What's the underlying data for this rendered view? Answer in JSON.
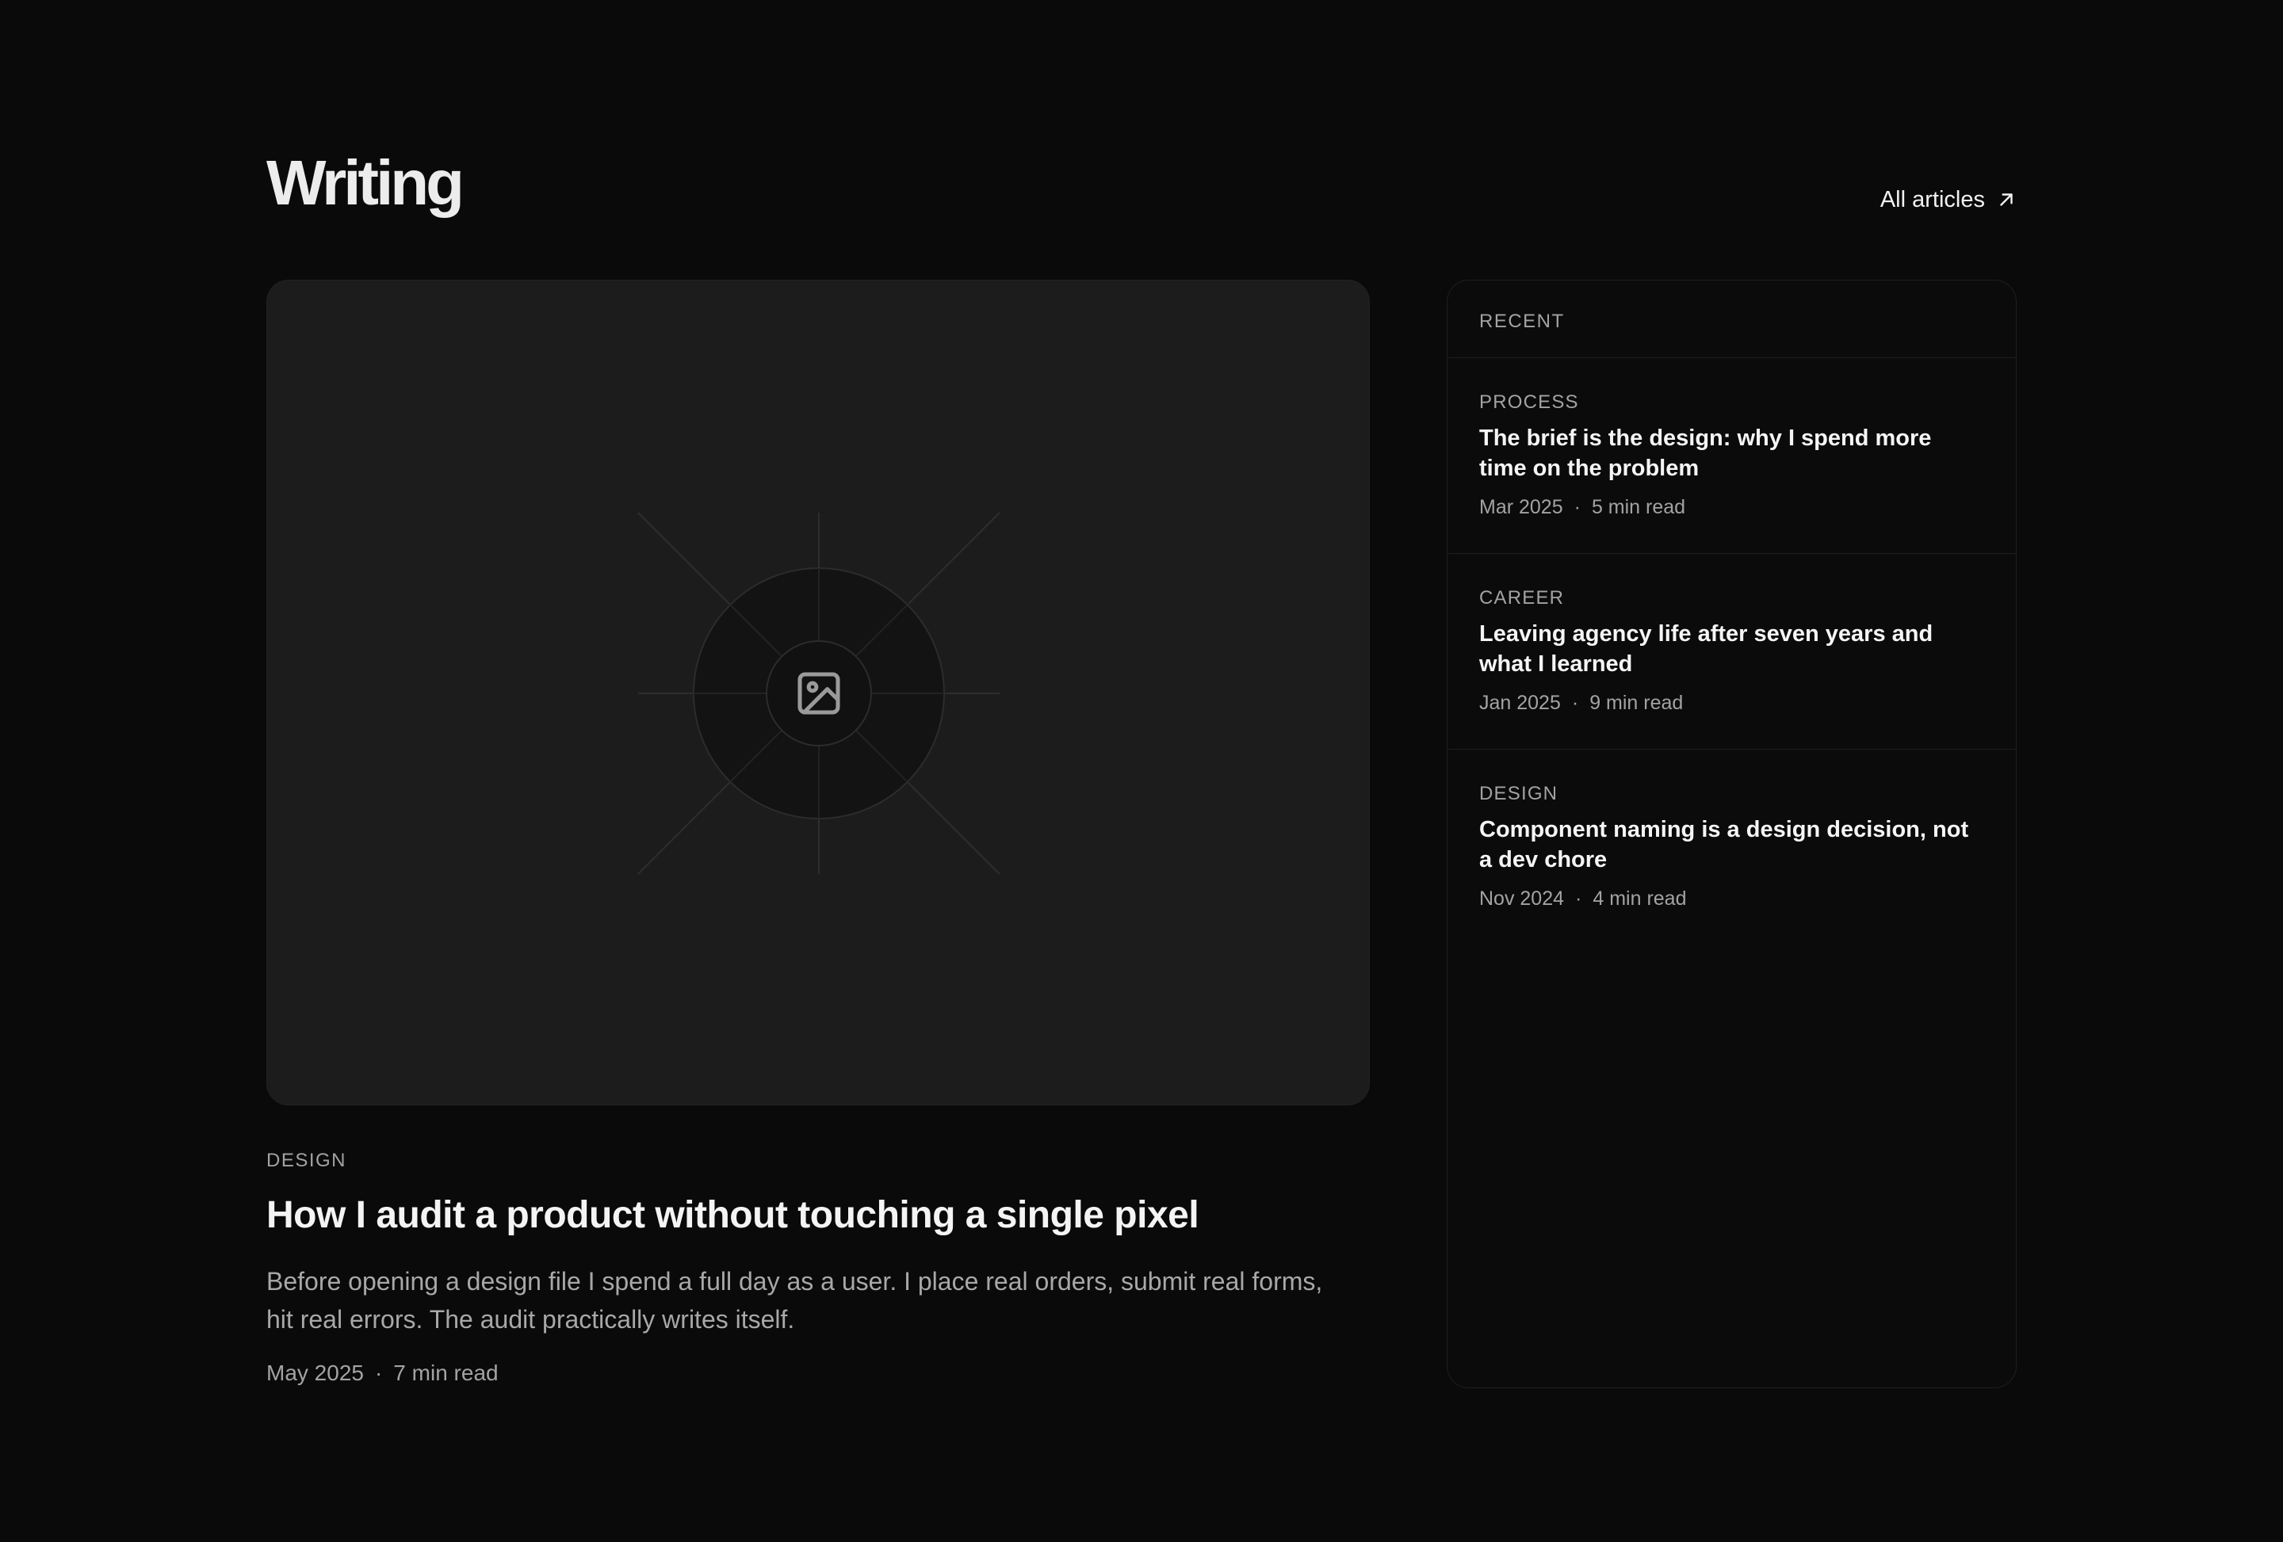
{
  "section": {
    "title": "Writing",
    "all_link_label": "All articles"
  },
  "feature": {
    "category": "DESIGN",
    "title": "How I audit a product without touching a single pixel",
    "description": "Before opening a design file I spend a full day as a user. I place real orders, submit real forms, hit real errors. The audit practically writes itself.",
    "date": "May 2025",
    "separator": "·",
    "read_time": "7 min read",
    "image_icon": "image-icon"
  },
  "sidebar": {
    "heading": "RECENT",
    "posts": [
      {
        "category": "PROCESS",
        "title": "The brief is the design: why I spend more time on the problem",
        "date": "Mar 2025",
        "separator": "·",
        "read_time": "5 min read"
      },
      {
        "category": "CAREER",
        "title": "Leaving agency life after seven years and what I learned",
        "date": "Jan 2025",
        "separator": "·",
        "read_time": "9 min read"
      },
      {
        "category": "DESIGN",
        "title": "Component naming is a design decision, not a dev chore",
        "date": "Nov 2024",
        "separator": "·",
        "read_time": "4 min read"
      }
    ]
  },
  "colors": {
    "background": "#0a0a0a",
    "card": "#1c1c1c",
    "text": "#f4f4f4",
    "muted": "#a3a3a3"
  },
  "icons": {
    "arrow": "arrow-up-right-icon"
  }
}
